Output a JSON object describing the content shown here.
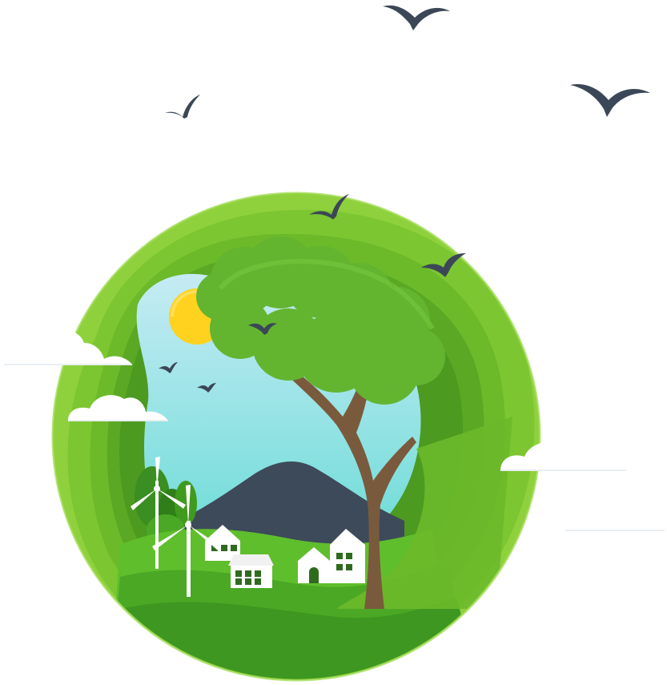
{
  "scene": {
    "subject": "eco-landscape-papercut",
    "palette": {
      "background": "#ffffff",
      "green_outer": "#8fd13c",
      "green_mid": "#6fbe2a",
      "green_deep": "#3f9a1e",
      "green_dark": "#2f7f18",
      "sky_top": "#b8e6f2",
      "sky_bottom": "#7fe0de",
      "sun": "#ffd21f",
      "mountain": "#3d4a5a",
      "tree_trunk": "#7a5a3c",
      "tree_foliage": "#5cb02c",
      "bird": "#3b4756",
      "cloud": "#ffffff",
      "house": "#ffffff",
      "window": "#2f6b1f"
    },
    "icons": [
      "bird-icon",
      "cloud-icon",
      "sun-icon",
      "tree-icon",
      "wind-turbine-icon",
      "house-icon",
      "mountain-icon"
    ]
  }
}
